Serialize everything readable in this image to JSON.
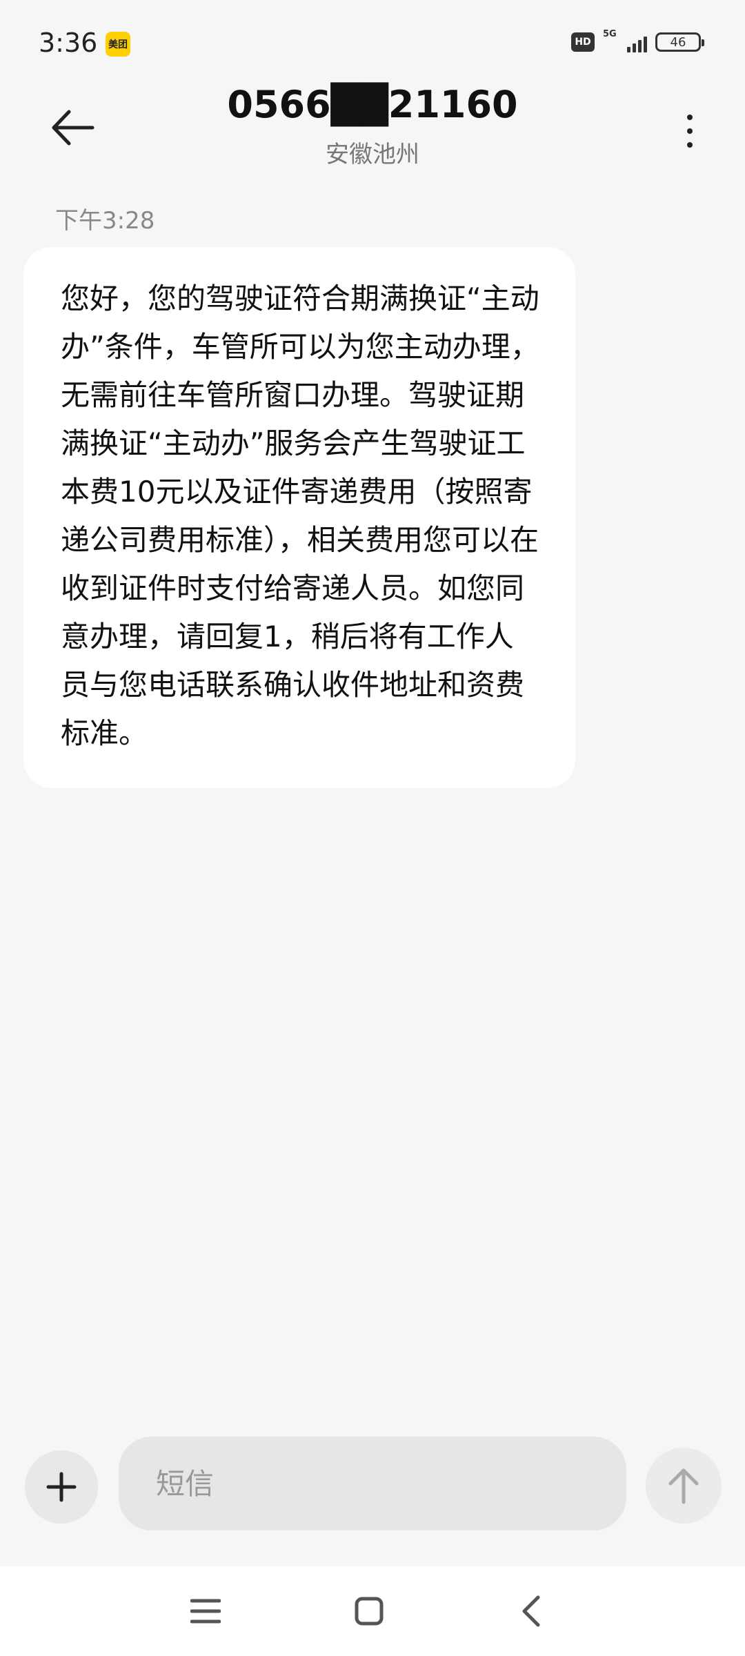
{
  "status_bar": {
    "time": "3:36",
    "app_badge": "美团",
    "hd": "HD",
    "network": "5G",
    "battery": "46"
  },
  "header": {
    "title": "0566██21160",
    "subtitle": "安徽池州"
  },
  "conversation": {
    "timestamp": "下午3:28",
    "message": "您好，您的驾驶证符合期满换证“主动办”条件，车管所可以为您主动办理，无需前往车管所窗口办理。驾驶证期满换证“主动办”服务会产生驾驶证工本费10元以及证件寄递费用（按照寄递公司费用标准），相关费用您可以在收到证件时支付给寄递人员。如您同意办理，请回复1，稍后将有工作人员与您电话联系确认收件地址和资费标准。"
  },
  "composer": {
    "placeholder": "短信"
  },
  "icons": {
    "back": "back-arrow-icon",
    "more": "more-vertical-icon",
    "add": "plus-icon",
    "send": "arrow-up-icon",
    "nav_menu": "menu-icon",
    "nav_home": "home-square-icon",
    "nav_back": "chevron-left-icon"
  },
  "colors": {
    "background": "#f6f6f6",
    "bubble": "#ffffff",
    "badge": "#ffd000"
  }
}
